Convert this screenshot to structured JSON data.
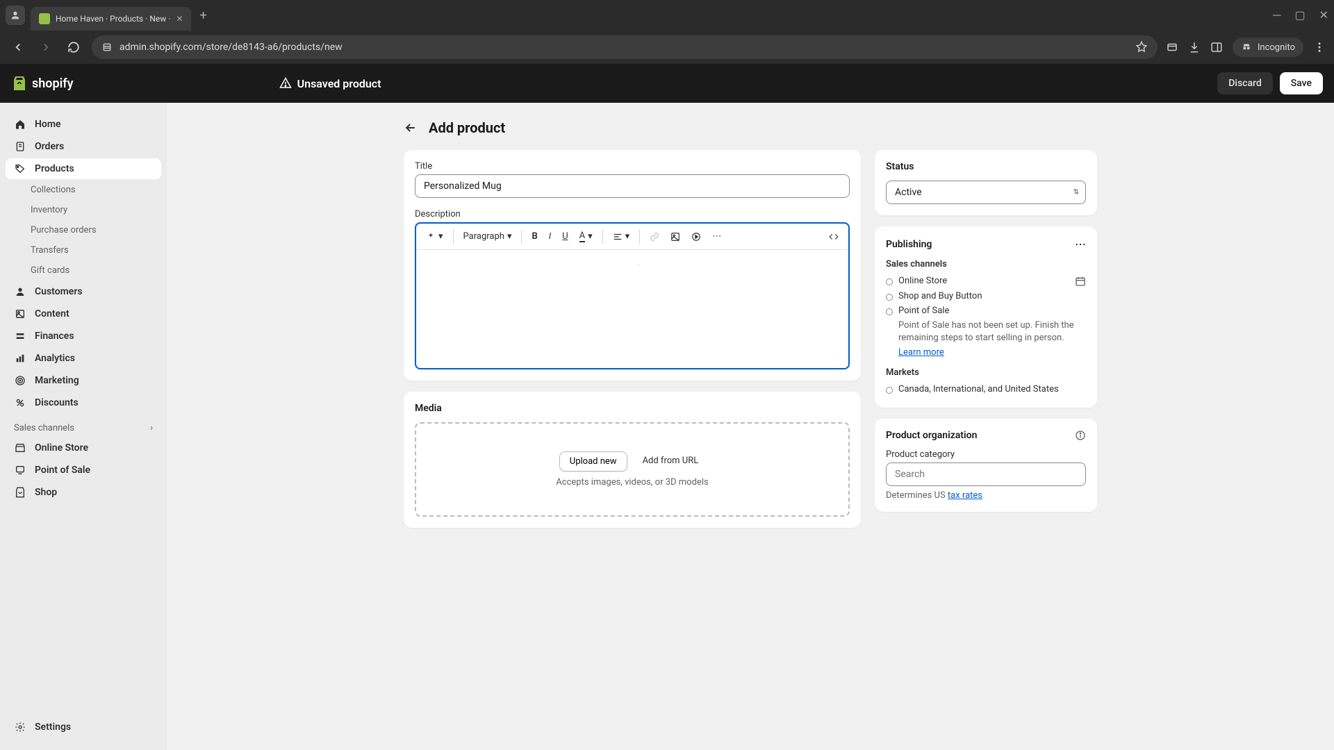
{
  "browser": {
    "tab_title": "Home Haven · Products · New ·",
    "url": "admin.shopify.com/store/de8143-a6/products/new",
    "incognito_label": "Incognito"
  },
  "header": {
    "logo_text": "shopify",
    "status_text": "Unsaved product",
    "discard_label": "Discard",
    "save_label": "Save"
  },
  "sidebar": {
    "home": "Home",
    "orders": "Orders",
    "products": "Products",
    "collections": "Collections",
    "inventory": "Inventory",
    "purchase_orders": "Purchase orders",
    "transfers": "Transfers",
    "gift_cards": "Gift cards",
    "customers": "Customers",
    "content": "Content",
    "finances": "Finances",
    "analytics": "Analytics",
    "marketing": "Marketing",
    "discounts": "Discounts",
    "sales_channels": "Sales channels",
    "online_store": "Online Store",
    "point_of_sale": "Point of Sale",
    "shop": "Shop",
    "settings": "Settings"
  },
  "page": {
    "title": "Add product"
  },
  "form": {
    "title_label": "Title",
    "title_value": "Personalized Mug",
    "description_label": "Description",
    "paragraph_label": "Paragraph"
  },
  "media": {
    "heading": "Media",
    "upload_label": "Upload new",
    "url_label": "Add from URL",
    "hint": "Accepts images, videos, or 3D models"
  },
  "status": {
    "heading": "Status",
    "value": "Active"
  },
  "publishing": {
    "heading": "Publishing",
    "sales_channels_label": "Sales channels",
    "channels": {
      "online_store": "Online Store",
      "shop_buy": "Shop and Buy Button",
      "pos": "Point of Sale"
    },
    "pos_note": "Point of Sale has not been set up. Finish the remaining steps to start selling in person.",
    "learn_more": "Learn more",
    "markets_label": "Markets",
    "markets_value": "Canada, International, and United States"
  },
  "organization": {
    "heading": "Product organization",
    "category_label": "Product category",
    "search_placeholder": "Search",
    "tax_hint_prefix": "Determines US ",
    "tax_link": "tax rates"
  }
}
